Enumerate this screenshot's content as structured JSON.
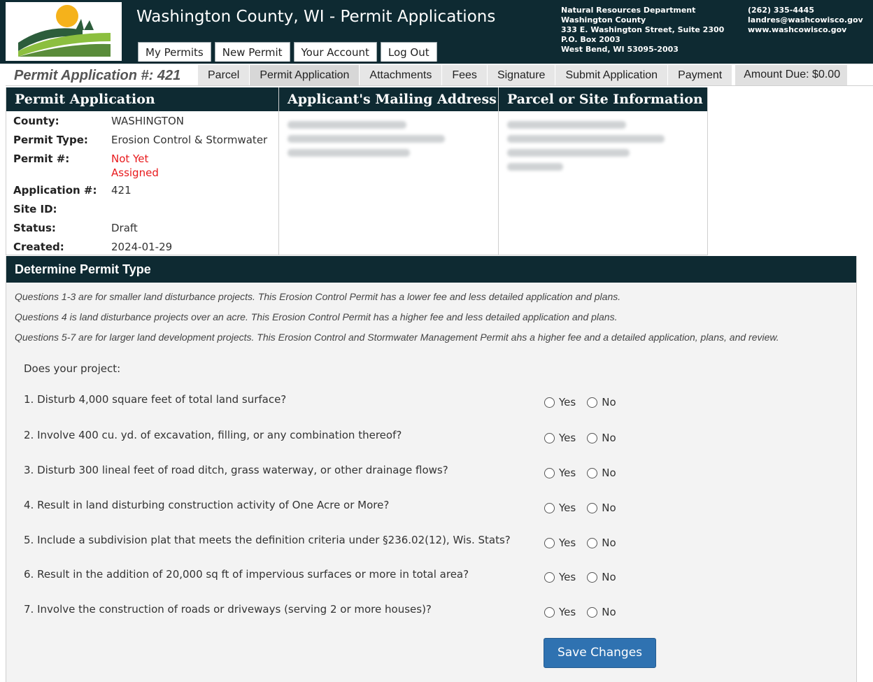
{
  "header": {
    "title": "Washington County, WI - Permit Applications",
    "nav": [
      "My Permits",
      "New Permit",
      "Your Account",
      "Log Out"
    ],
    "dept_lines": [
      "Natural Resources Department",
      "Washington County",
      "333 E. Washington Street, Suite 2300",
      "P.O. Box 2003",
      "West Bend, WI 53095-2003"
    ],
    "contact_lines": [
      "(262) 335-4445",
      "landres@washcowisco.gov",
      "www.washcowisco.gov"
    ]
  },
  "subbar": {
    "application_label": "Permit Application #: 421",
    "tabs": [
      "Parcel",
      "Permit Application",
      "Attachments",
      "Fees",
      "Signature",
      "Submit Application",
      "Payment"
    ],
    "amount_due": "Amount Due: $0.00"
  },
  "panels": {
    "permit_application": {
      "title": "Permit Application",
      "rows": [
        {
          "label": "County:",
          "value": "WASHINGTON"
        },
        {
          "label": "Permit Type:",
          "value": "Erosion Control & Stormwater"
        },
        {
          "label": "Permit #:",
          "value": "Not Yet Assigned"
        },
        {
          "label": "Application #:",
          "value": "421"
        },
        {
          "label": "Site ID:",
          "value": ""
        },
        {
          "label": "Status:",
          "value": "Draft"
        },
        {
          "label": "Created:",
          "value": "2024-01-29"
        }
      ]
    },
    "mailing_address": {
      "title": "Applicant's Mailing Address"
    },
    "parcel_info": {
      "title": "Parcel or Site Information"
    }
  },
  "permit_type": {
    "title": "Determine Permit Type",
    "notes": [
      "Questions 1-3 are for smaller land disturbance projects. This Erosion Control Permit has a lower fee and less detailed application and plans.",
      "Questions 4 is land disturbance projects over an acre. This Erosion Control Permit has a higher fee and less detailed application and plans.",
      "Questions 5-7 are for larger land development projects. This Erosion Control and Stormwater Management Permit ahs a higher fee and a detailed application, plans, and review."
    ],
    "intro": "Does your project:",
    "questions": [
      "1. Disturb 4,000 square feet of total land surface?",
      "2. Involve 400 cu. yd. of excavation, filling, or any combination thereof?",
      "3. Disturb 300 lineal feet of road ditch, grass waterway, or other drainage flows?",
      "4. Result in land disturbing construction activity of One Acre or More?",
      "5. Include a subdivision plat that meets the definition criteria under §236.02(12), Wis. Stats?",
      "6. Result in the addition of 20,000 sq ft of impervious surfaces or more in total area?",
      "7. Involve the construction of roads or driveways (serving 2 or more houses)?"
    ],
    "yes_label": "Yes",
    "no_label": "No",
    "save_label": "Save Changes"
  },
  "colors": {
    "header_bg": "#0e2a32",
    "accent_button": "#2f72b1",
    "warning_text": "#e8191c"
  }
}
